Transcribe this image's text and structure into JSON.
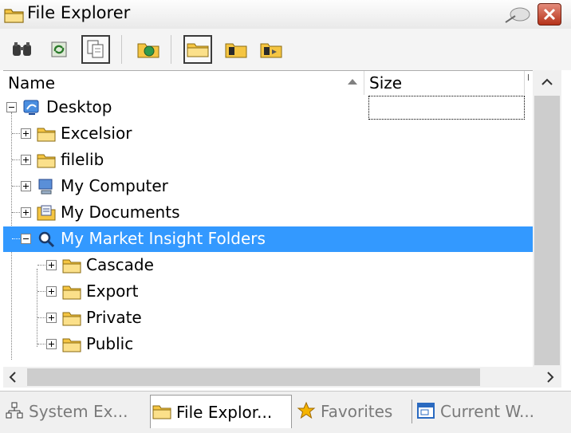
{
  "window": {
    "title": "File Explorer",
    "icons": [
      "folder-icon",
      "pin-icon",
      "close-icon"
    ]
  },
  "toolbar": {
    "buttons": [
      {
        "name": "find-icon",
        "pressed": false
      },
      {
        "name": "refresh-icon",
        "pressed": false
      },
      {
        "name": "copy-icon",
        "pressed": true
      },
      {
        "name": "folder-globe-icon",
        "pressed": false
      },
      {
        "name": "folder-open-icon",
        "pressed": true
      },
      {
        "name": "folder-back-icon",
        "pressed": false
      },
      {
        "name": "folder-forward-icon",
        "pressed": false
      }
    ]
  },
  "columns": {
    "name": "Name",
    "size": "Size"
  },
  "tree": {
    "items": [
      {
        "label": "Desktop",
        "icon": "desktop-icon",
        "expanded": true
      },
      {
        "label": "Excelsior",
        "icon": "folder-icon",
        "expanded": false
      },
      {
        "label": "filelib",
        "icon": "folder-icon",
        "expanded": false
      },
      {
        "label": "My Computer",
        "icon": "computer-icon",
        "expanded": false
      },
      {
        "label": "My Documents",
        "icon": "documents-icon",
        "expanded": false
      },
      {
        "label": "My Market Insight Folders",
        "icon": "search-folder-icon",
        "expanded": true,
        "selected": true
      },
      {
        "label": "Cascade",
        "icon": "folder-icon",
        "expanded": false
      },
      {
        "label": "Export",
        "icon": "folder-icon",
        "expanded": false
      },
      {
        "label": "Private",
        "icon": "folder-icon",
        "expanded": false
      },
      {
        "label": "Public",
        "icon": "folder-icon",
        "expanded": false
      }
    ]
  },
  "tabs": [
    {
      "label": "System Ex...",
      "icon": "network-icon",
      "active": false
    },
    {
      "label": "File Explor...",
      "icon": "folder-icon",
      "active": true
    },
    {
      "label": "Favorites",
      "icon": "star-icon",
      "active": false
    },
    {
      "label": "Current W...",
      "icon": "window-icon",
      "active": false
    }
  ],
  "colors": {
    "selection": "#3399ff",
    "folder": "#f5c542",
    "close_button": "#c0402a"
  }
}
